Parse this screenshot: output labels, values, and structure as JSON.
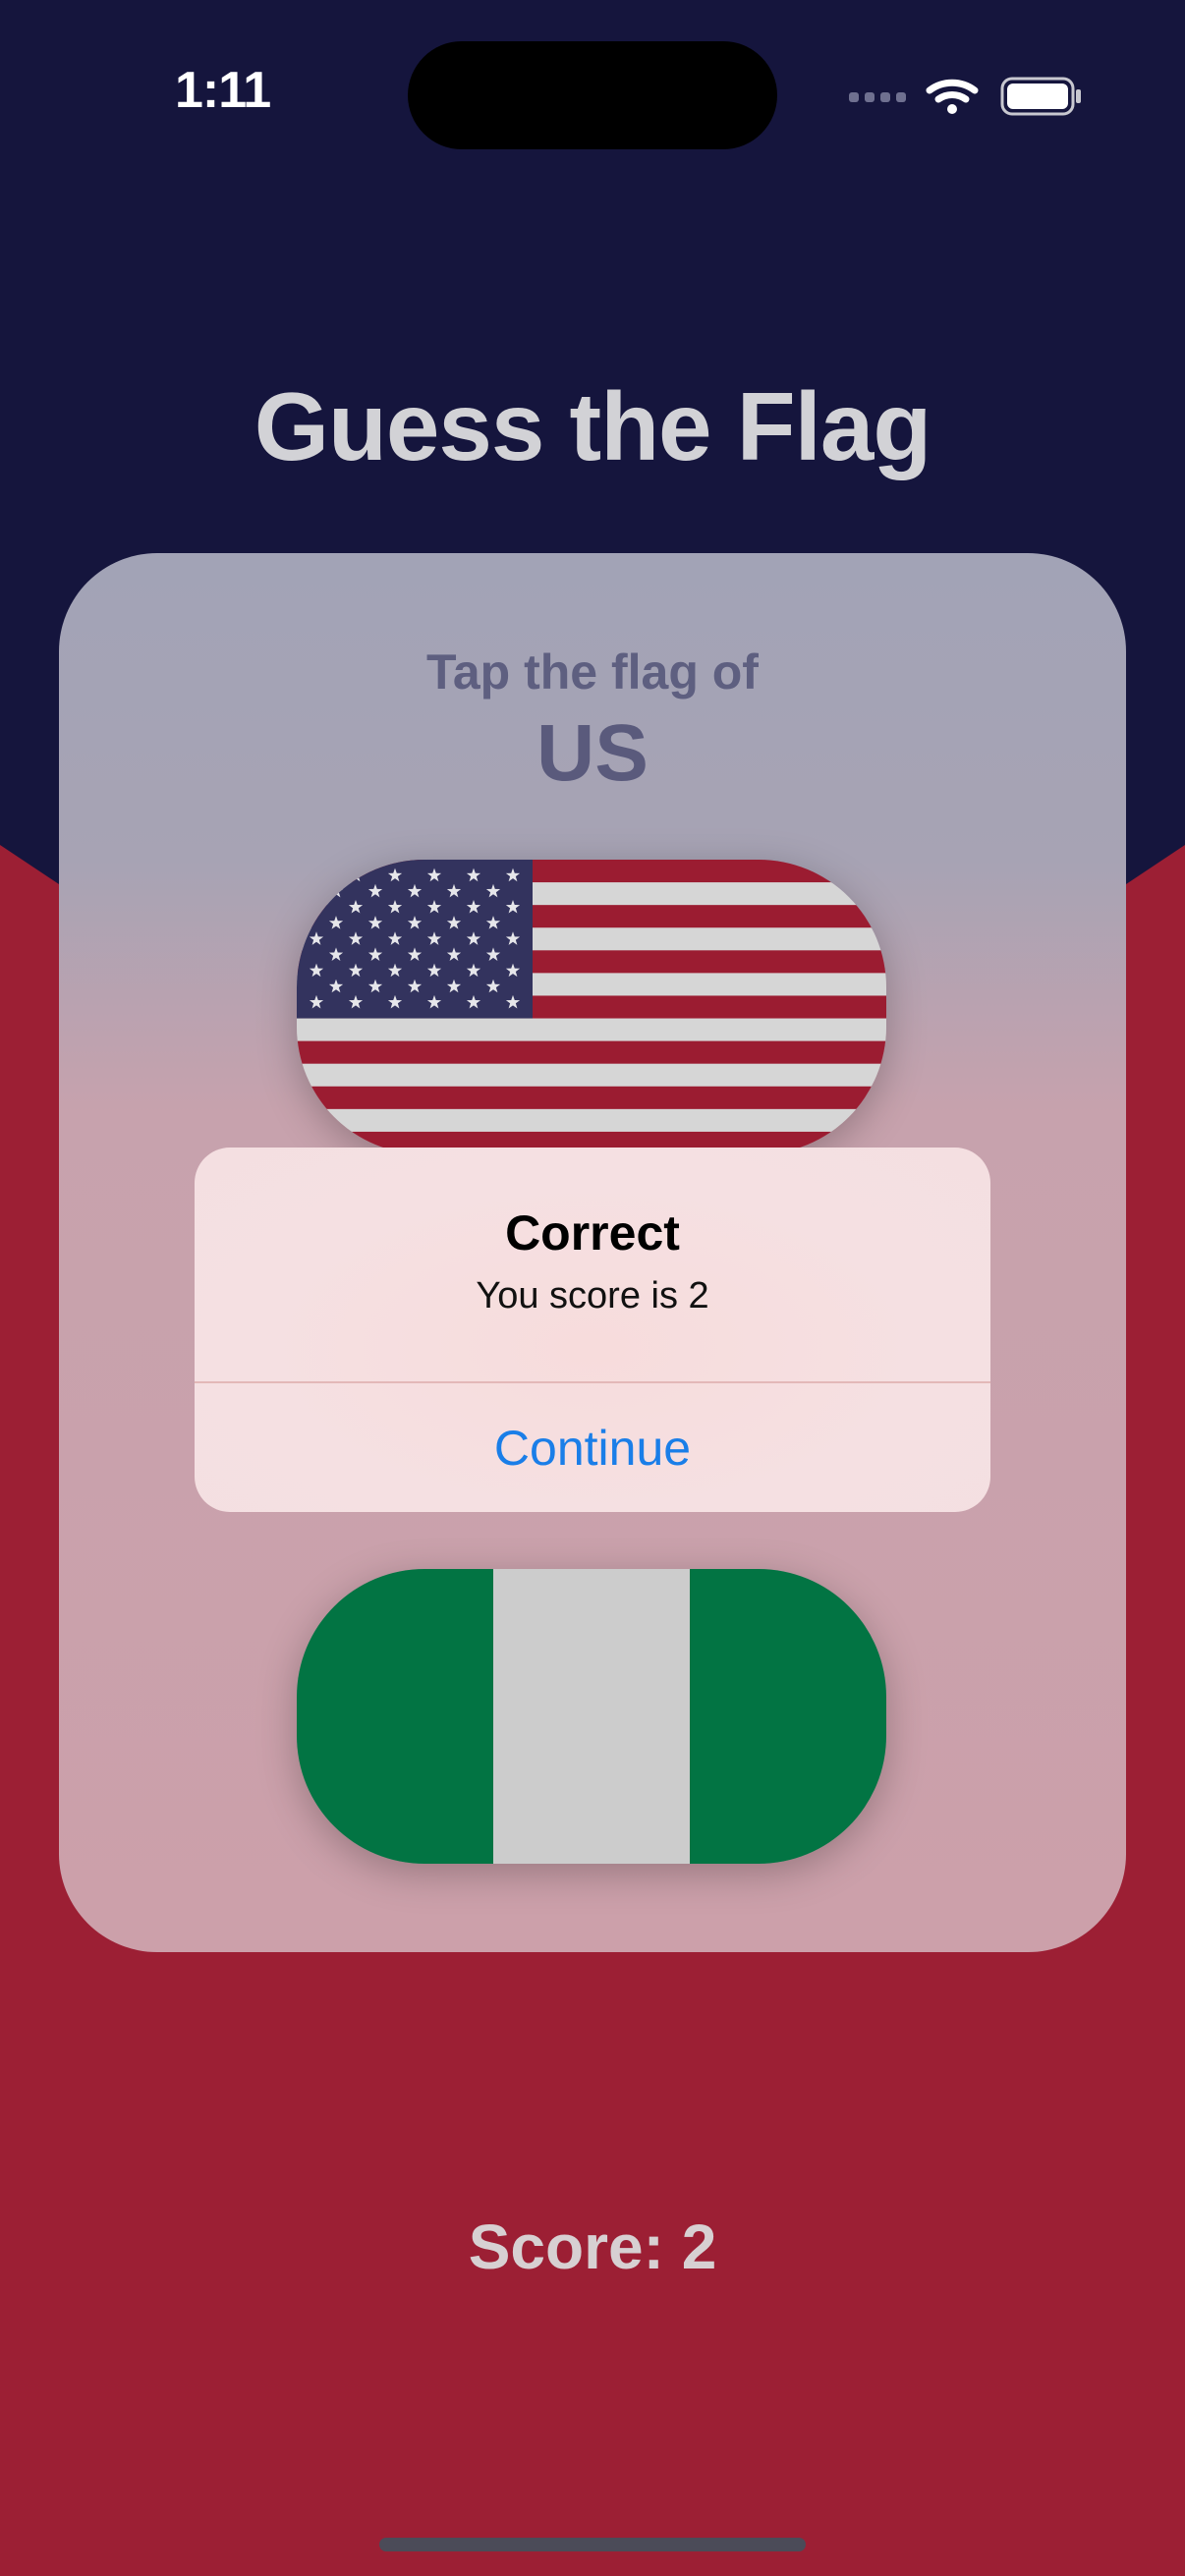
{
  "status_bar": {
    "time": "1:11",
    "icons": [
      "cellular-signal-icon",
      "wifi-icon",
      "battery-icon"
    ]
  },
  "header": {
    "title": "Guess the Flag"
  },
  "question": {
    "prompt": "Tap the flag of",
    "country": "US"
  },
  "flags": [
    {
      "name": "us-flag",
      "visible": "fully"
    },
    {
      "name": "nigeria-flag",
      "visible": "fully"
    }
  ],
  "alert": {
    "title": "Correct",
    "message": "You score is 2",
    "button_label": "Continue"
  },
  "footer": {
    "score": "Score: 2"
  },
  "colors": {
    "top_background": "#15153d",
    "bottom_background": "#9c1f34",
    "accent_blue": "#1a7ee8",
    "us_red": "#9b1c31",
    "us_blue": "#33335e",
    "nigeria_green": "#027443"
  }
}
